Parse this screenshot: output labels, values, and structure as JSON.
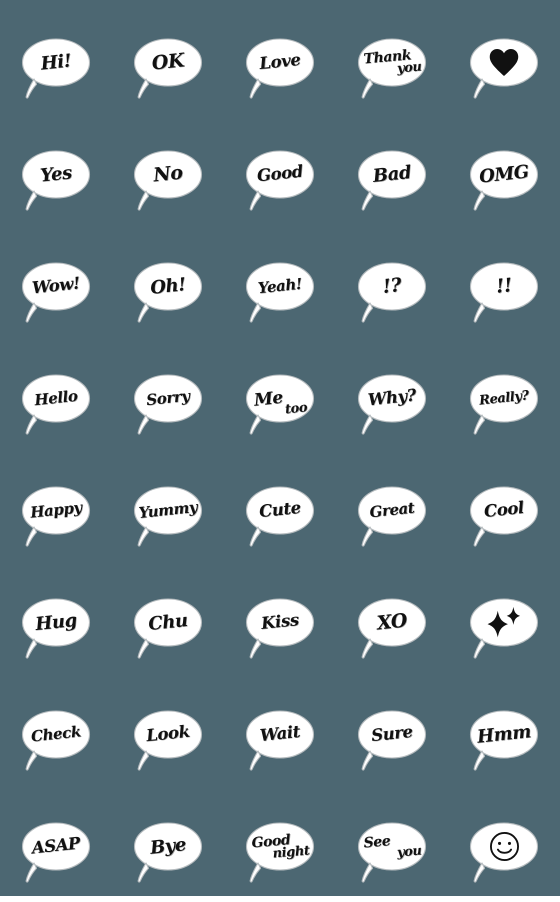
{
  "sheet": {
    "background_color": "#4c6772",
    "bubble_fill": "#ffffff",
    "bubble_outline": "#b9bfc2",
    "ink_color": "#111111",
    "columns": 5,
    "rows": 8,
    "sticker_count": 40
  },
  "stickers": [
    {
      "id": "hi",
      "type": "text",
      "label": "Hi!"
    },
    {
      "id": "ok",
      "type": "text",
      "label": "OK"
    },
    {
      "id": "love",
      "type": "text",
      "label": "Love"
    },
    {
      "id": "thank-you",
      "type": "stacked",
      "label": "Thank you",
      "line_1": "Thank",
      "line_2": "you"
    },
    {
      "id": "heart",
      "type": "symbol",
      "label": "heart",
      "icon": "heart-icon"
    },
    {
      "id": "yes",
      "type": "text",
      "label": "Yes"
    },
    {
      "id": "no",
      "type": "text",
      "label": "No"
    },
    {
      "id": "good",
      "type": "text",
      "label": "Good"
    },
    {
      "id": "bad",
      "type": "text",
      "label": "Bad"
    },
    {
      "id": "omg",
      "type": "text",
      "label": "OMG"
    },
    {
      "id": "wow",
      "type": "text",
      "label": "Wow!"
    },
    {
      "id": "oh",
      "type": "text",
      "label": "Oh!"
    },
    {
      "id": "yeah",
      "type": "text",
      "label": "Yeah!"
    },
    {
      "id": "interrobang",
      "type": "text",
      "label": "!?"
    },
    {
      "id": "double-bang",
      "type": "text",
      "label": "!!"
    },
    {
      "id": "hello",
      "type": "text",
      "label": "Hello"
    },
    {
      "id": "sorry",
      "type": "text",
      "label": "Sorry"
    },
    {
      "id": "me-too",
      "type": "pair",
      "label": "Me too",
      "line_1": "Me",
      "line_2": "too"
    },
    {
      "id": "why",
      "type": "text",
      "label": "Why?"
    },
    {
      "id": "really",
      "type": "text",
      "label": "Really?"
    },
    {
      "id": "happy",
      "type": "text",
      "label": "Happy"
    },
    {
      "id": "yummy",
      "type": "text",
      "label": "Yummy"
    },
    {
      "id": "cute",
      "type": "text",
      "label": "Cute"
    },
    {
      "id": "great",
      "type": "text",
      "label": "Great"
    },
    {
      "id": "cool",
      "type": "text",
      "label": "Cool"
    },
    {
      "id": "hug",
      "type": "text",
      "label": "Hug"
    },
    {
      "id": "chu",
      "type": "text",
      "label": "Chu"
    },
    {
      "id": "kiss",
      "type": "text",
      "label": "Kiss"
    },
    {
      "id": "xo",
      "type": "text",
      "label": "XO"
    },
    {
      "id": "sparkles",
      "type": "symbol",
      "label": "sparkles",
      "icon": "sparkles-icon"
    },
    {
      "id": "check",
      "type": "text",
      "label": "Check"
    },
    {
      "id": "look",
      "type": "text",
      "label": "Look"
    },
    {
      "id": "wait",
      "type": "text",
      "label": "Wait"
    },
    {
      "id": "sure",
      "type": "text",
      "label": "Sure"
    },
    {
      "id": "hmm",
      "type": "text",
      "label": "Hmm"
    },
    {
      "id": "asap",
      "type": "text",
      "label": "ASAP"
    },
    {
      "id": "bye",
      "type": "text",
      "label": "Bye"
    },
    {
      "id": "good-night",
      "type": "stacked",
      "label": "Good night",
      "line_1": "Good",
      "line_2": "night"
    },
    {
      "id": "see-you",
      "type": "stacked",
      "label": "See you",
      "line_1": "See",
      "line_2": "you"
    },
    {
      "id": "smiley",
      "type": "symbol",
      "label": "smiley",
      "icon": "smiley-icon"
    }
  ]
}
